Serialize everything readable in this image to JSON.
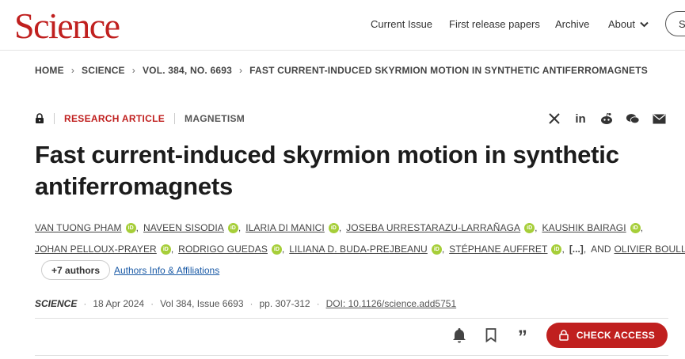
{
  "site": {
    "logo": "Science"
  },
  "nav": {
    "current_issue": "Current Issue",
    "first_release": "First release papers",
    "archive": "Archive",
    "about": "About",
    "search": "S"
  },
  "breadcrumb": [
    "HOME",
    "SCIENCE",
    "VOL. 384, NO. 6693",
    "FAST CURRENT-INDUCED SKYRMION MOTION IN SYNTHETIC ANTIFERROMAGNETS"
  ],
  "article": {
    "type": "RESEARCH ARTICLE",
    "subject": "MAGNETISM",
    "title": "Fast current-induced skyrmion motion in synthetic antiferromagnets",
    "authors_line1": [
      "VAN TUONG PHAM",
      "NAVEEN SISODIA",
      "ILARIA DI MANICI",
      "JOSEBA URRESTARAZU-LARRAÑAGA",
      "KAUSHIK BAIRAGI"
    ],
    "authors_line2": [
      "JOHAN PELLOUX-PRAYER",
      "RODRIGO GUEDAS",
      "LILIANA D. BUDA-PREJBEANU",
      "STÉPHANE AUFFRET"
    ],
    "ellipsis": "[...]",
    "and": "AND",
    "last_author": "OLIVIER BOULLE",
    "more_authors": "+7 authors",
    "affiliations_link": "Authors Info & Affiliations",
    "journal": "SCIENCE",
    "date": "18 Apr 2024",
    "volume": "Vol 384, Issue 6693",
    "pages": "pp. 307-312",
    "doi": "DOI: 10.1126/science.add5751",
    "orcid_label": "iD"
  },
  "actions": {
    "check_access": "CHECK ACCESS"
  },
  "colors": {
    "brand": "#c0201f",
    "orcid": "#a6ce39",
    "link": "#1a5aa6"
  }
}
